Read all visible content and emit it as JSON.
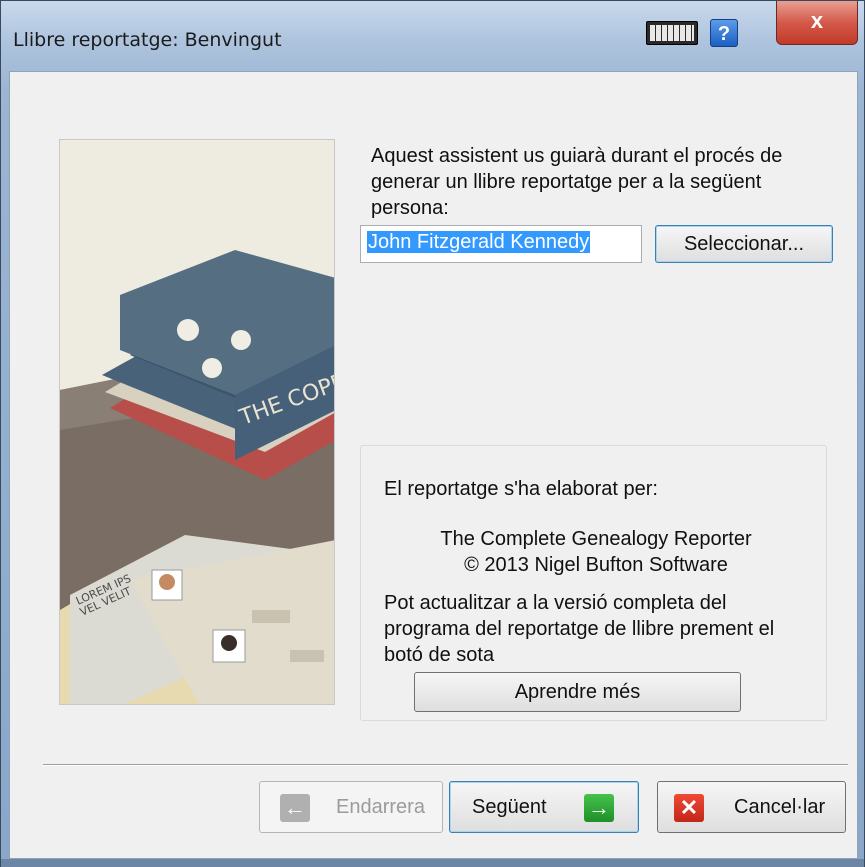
{
  "window": {
    "title": "Llibre reportatge: Benvingut",
    "close_symbol": "x",
    "help_symbol": "?"
  },
  "intro": {
    "text": "Aquest assistent us guiarà durant el procés de generar un llibre reportatge per a la següent persona:",
    "person_name": "John Fitzgerald Kennedy",
    "select_button": "Seleccionar..."
  },
  "panel": {
    "heading": "El reportatge s'ha elaborat per:",
    "product": "The Complete Genealogy Reporter",
    "copyright": "© 2013 Nigel Bufton Software",
    "upgrade_text": "Pot actualitzar a la versió completa del programa del reportatge de llibre prement el botó de sota",
    "learn_button": "Aprendre més"
  },
  "illustration": {
    "book_spine_text": "THE COPP",
    "card_text_1": "LOREM IPS",
    "card_text_2": "VEL VELIT"
  },
  "nav": {
    "back": "Endarrera",
    "next": "Següent",
    "cancel": "Cancel·lar"
  }
}
